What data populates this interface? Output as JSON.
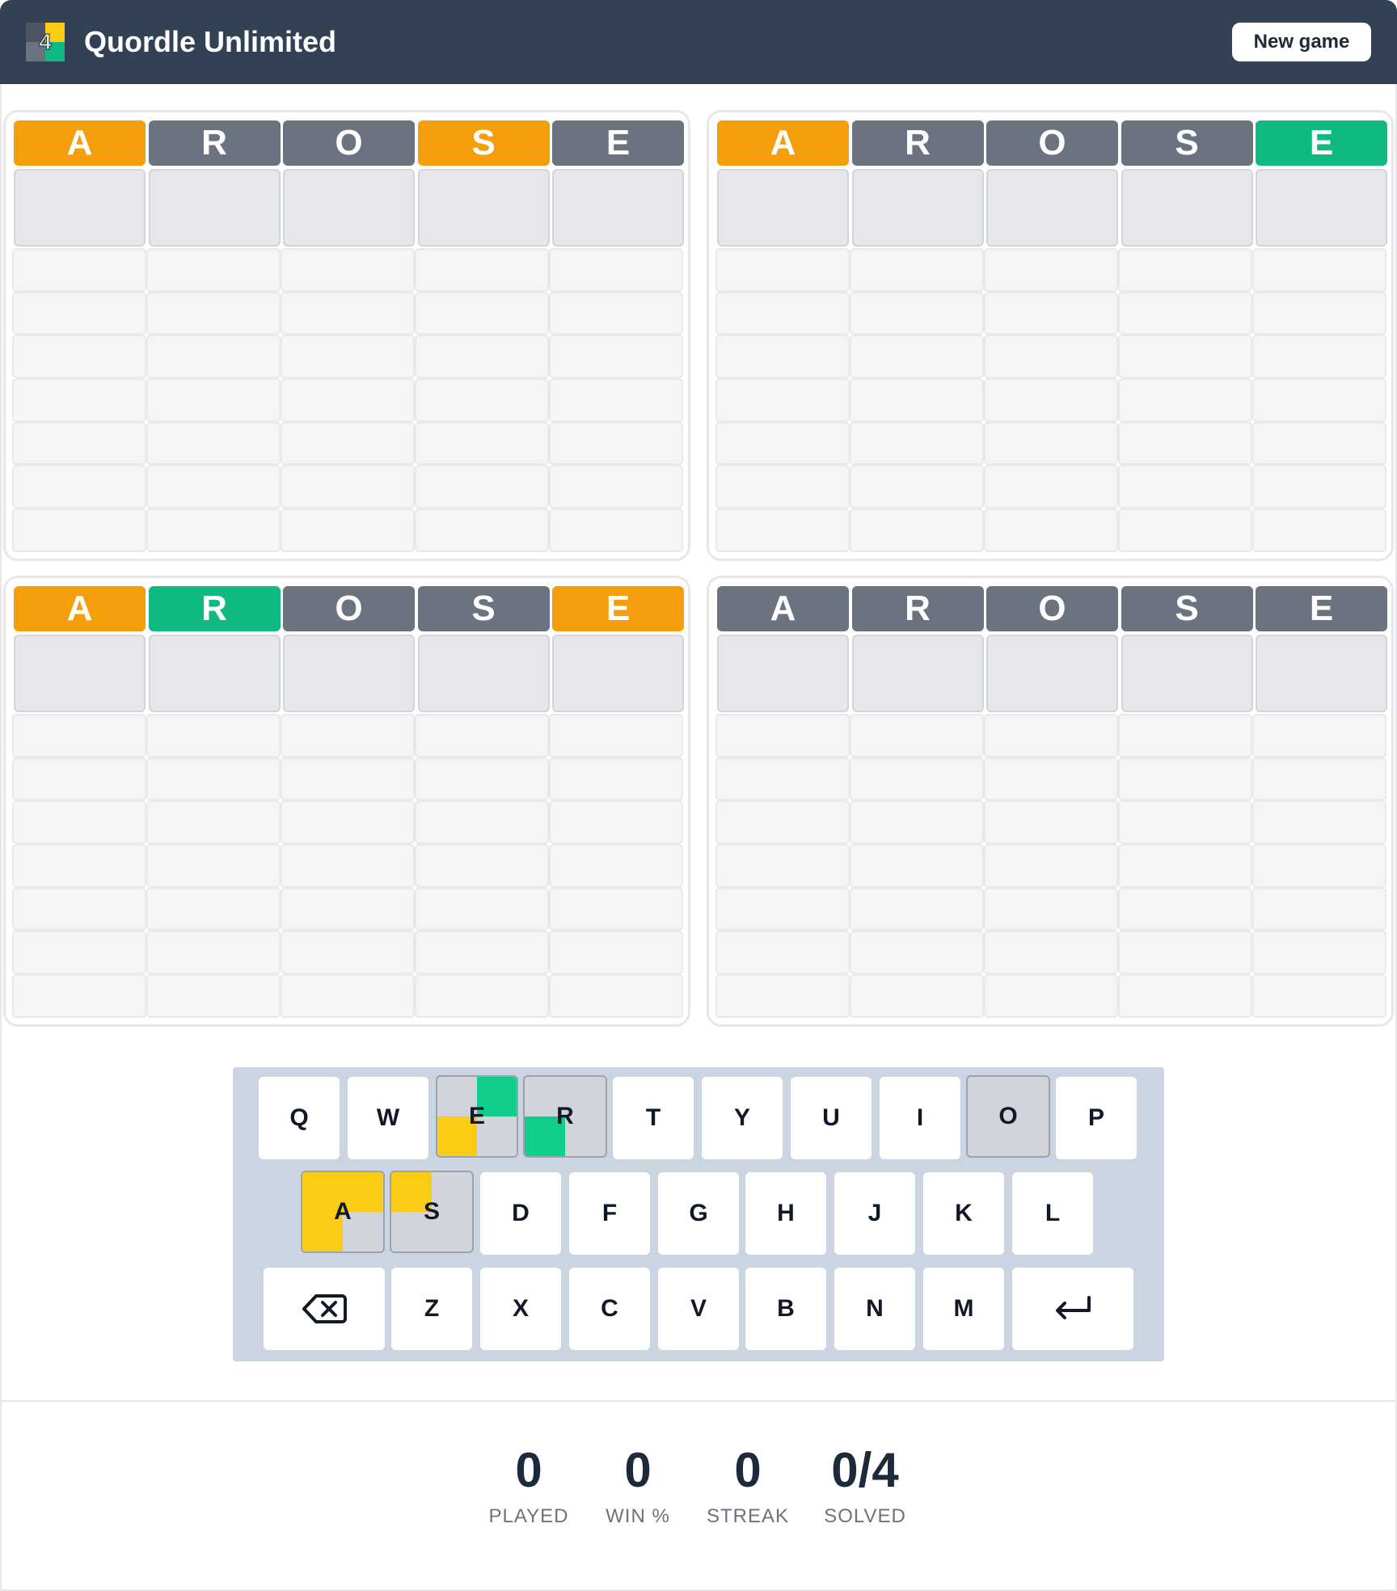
{
  "header": {
    "logo_number": "4",
    "title": "Quordle Unlimited",
    "new_game_label": "New game"
  },
  "boards": [
    {
      "guess": [
        {
          "letter": "A",
          "state": "yellow"
        },
        {
          "letter": "R",
          "state": "gray"
        },
        {
          "letter": "O",
          "state": "gray"
        },
        {
          "letter": "S",
          "state": "yellow"
        },
        {
          "letter": "E",
          "state": "gray"
        }
      ]
    },
    {
      "guess": [
        {
          "letter": "A",
          "state": "yellow"
        },
        {
          "letter": "R",
          "state": "gray"
        },
        {
          "letter": "O",
          "state": "gray"
        },
        {
          "letter": "S",
          "state": "gray"
        },
        {
          "letter": "E",
          "state": "green"
        }
      ]
    },
    {
      "guess": [
        {
          "letter": "A",
          "state": "yellow"
        },
        {
          "letter": "R",
          "state": "green"
        },
        {
          "letter": "O",
          "state": "gray"
        },
        {
          "letter": "S",
          "state": "gray"
        },
        {
          "letter": "E",
          "state": "yellow"
        }
      ]
    },
    {
      "guess": [
        {
          "letter": "A",
          "state": "gray"
        },
        {
          "letter": "R",
          "state": "gray"
        },
        {
          "letter": "O",
          "state": "gray"
        },
        {
          "letter": "S",
          "state": "gray"
        },
        {
          "letter": "E",
          "state": "gray"
        }
      ]
    }
  ],
  "keyboard": {
    "row1": [
      "Q",
      "W",
      "E",
      "R",
      "T",
      "Y",
      "U",
      "I",
      "O",
      "P"
    ],
    "row2": [
      "A",
      "S",
      "D",
      "F",
      "G",
      "H",
      "J",
      "K",
      "L"
    ],
    "row3": [
      "Z",
      "X",
      "C",
      "V",
      "B",
      "N",
      "M"
    ],
    "backspace_icon": "backspace-icon",
    "enter_icon": "enter-arrow-icon"
  },
  "colors": {
    "gray": "#6b7280",
    "yellow": "#f59e0b",
    "green": "#10b981",
    "header": "#334155"
  },
  "stats": [
    {
      "value": "0",
      "label": "PLAYED"
    },
    {
      "value": "0",
      "label": "WIN %"
    },
    {
      "value": "0",
      "label": "STREAK"
    },
    {
      "value": "0/4",
      "label": "SOLVED"
    }
  ]
}
